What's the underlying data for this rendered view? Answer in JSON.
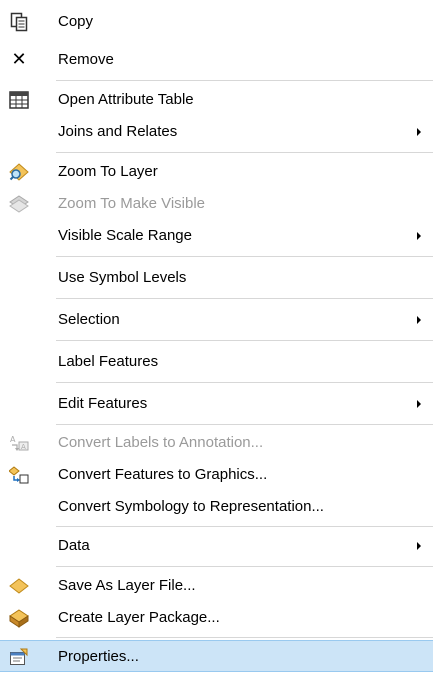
{
  "menu": {
    "items": [
      {
        "label": "Copy",
        "icon": "copy-icon"
      },
      {
        "label": "Remove",
        "icon": "remove-icon"
      },
      {
        "label": "Open Attribute Table",
        "icon": "attribute-table-icon"
      },
      {
        "label": "Joins and Relates",
        "submenu": true
      },
      {
        "label": "Zoom To Layer",
        "icon": "zoom-to-layer-icon"
      },
      {
        "label": "Zoom To Make Visible",
        "icon": "zoom-to-make-visible-icon",
        "disabled": true
      },
      {
        "label": "Visible Scale Range",
        "submenu": true
      },
      {
        "label": "Use Symbol Levels"
      },
      {
        "label": "Selection",
        "submenu": true
      },
      {
        "label": "Label Features"
      },
      {
        "label": "Edit Features",
        "submenu": true
      },
      {
        "label": "Convert Labels to Annotation...",
        "icon": "convert-labels-icon",
        "disabled": true
      },
      {
        "label": "Convert Features to Graphics...",
        "icon": "convert-features-icon"
      },
      {
        "label": "Convert Symbology to Representation..."
      },
      {
        "label": "Data",
        "submenu": true
      },
      {
        "label": "Save As Layer File...",
        "icon": "layer-file-icon"
      },
      {
        "label": "Create Layer Package...",
        "icon": "layer-package-icon"
      },
      {
        "label": "Properties...",
        "icon": "properties-icon",
        "selected": true
      }
    ]
  },
  "colors": {
    "highlight": "#cce4f7",
    "highlight_border": "#99c9ef",
    "disabled_text": "#9a9a9a",
    "separator": "#d7d7d7"
  }
}
